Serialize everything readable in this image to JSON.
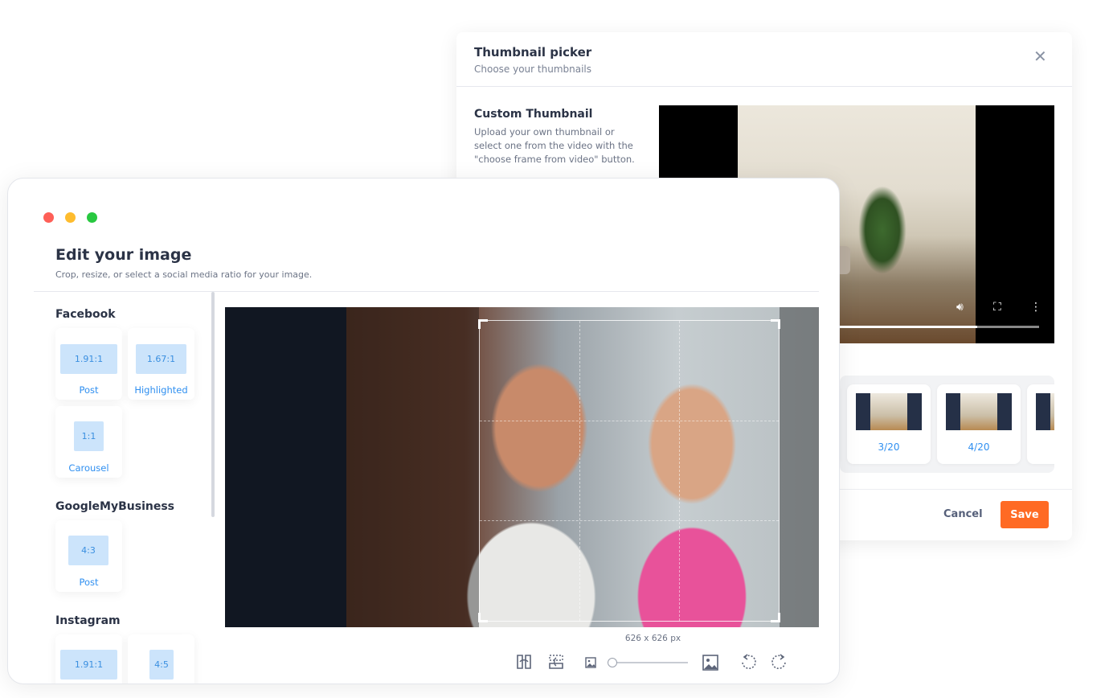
{
  "picker": {
    "title": "Thumbnail picker",
    "subtitle": "Choose your thumbnails",
    "custom_title": "Custom Thumbnail",
    "custom_desc": "Upload your own thumbnail or select one from the video with the \"choose frame from video\" button.",
    "video_progress": 0.69,
    "frames": [
      {
        "label": ""
      },
      {
        "label": "3/20"
      },
      {
        "label": "4/20"
      },
      {
        "label": ""
      }
    ],
    "cancel_label": "Cancel",
    "save_label": "Save",
    "accent": "#ff6a24"
  },
  "editor": {
    "title": "Edit your image",
    "subtitle": "Crop, resize, or select a social media ratio for your image.",
    "dimensions": "626 x 626 px",
    "zoom_level": 0,
    "sections": [
      {
        "name": "Facebook",
        "ratios": [
          {
            "ratio": "1.91:1",
            "label": "Post"
          },
          {
            "ratio": "1.67:1",
            "label": "Highlighted"
          },
          {
            "ratio": "1:1",
            "label": "Carousel"
          }
        ]
      },
      {
        "name": "GoogleMyBusiness",
        "ratios": [
          {
            "ratio": "4:3",
            "label": "Post"
          }
        ]
      },
      {
        "name": "Instagram",
        "ratios": [
          {
            "ratio": "1.91:1",
            "label": ""
          },
          {
            "ratio": "4:5",
            "label": ""
          }
        ]
      }
    ]
  }
}
